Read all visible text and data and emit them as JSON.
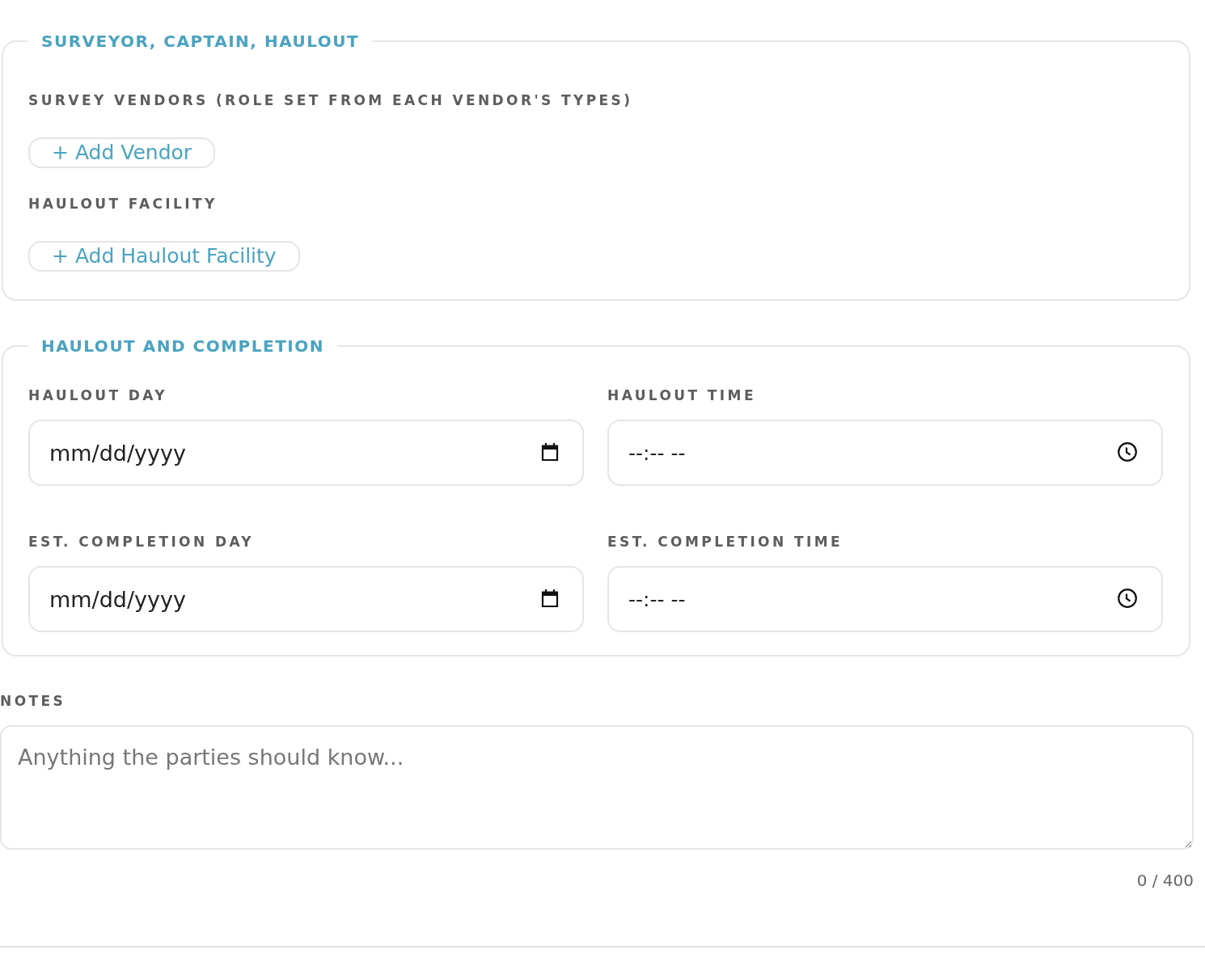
{
  "sections": [
    {
      "legend": "SURVEYOR, CAPTAIN, HAULOUT",
      "kind": "pickers",
      "groups": [
        {
          "label": "SURVEY VENDORS (ROLE SET FROM EACH VENDOR'S TYPES)",
          "button": "+ Add Vendor"
        },
        {
          "label": "HAULOUT FACILITY",
          "button": "+ Add Haulout Facility"
        }
      ]
    },
    {
      "legend": "HAULOUT AND COMPLETION",
      "kind": "schedule",
      "fields": [
        {
          "label": "HAULOUT DAY",
          "kind": "date",
          "placeholder": "mm/dd/yyyy"
        },
        {
          "label": "HAULOUT TIME",
          "kind": "time",
          "placeholder": "--:-- --"
        },
        {
          "label": "EST. COMPLETION DAY",
          "kind": "date",
          "placeholder": "mm/dd/yyyy"
        },
        {
          "label": "EST. COMPLETION TIME",
          "kind": "time",
          "placeholder": "--:-- --"
        }
      ]
    }
  ],
  "notes": {
    "label": "NOTES",
    "placeholder": "Anything the parties should know...",
    "counter": "0 / 400"
  }
}
